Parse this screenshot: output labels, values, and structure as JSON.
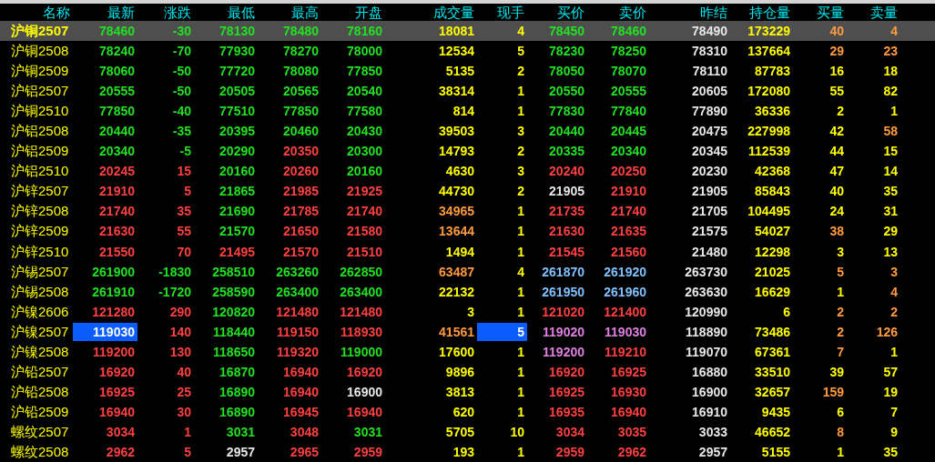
{
  "table": {
    "columns": [
      "名称",
      "最新",
      "涨跌",
      "最低",
      "最高",
      "开盘",
      "成交量",
      "现手",
      "买价",
      "卖价",
      "昨结",
      "持仓量",
      "买量",
      "卖量"
    ],
    "rows": [
      {
        "selected": true,
        "cells": [
          {
            "text": "沪铜2507",
            "color": "#ffff00",
            "highlighted": false
          },
          {
            "text": "78460",
            "color": "#22e022",
            "highlighted": false
          },
          {
            "text": "-30",
            "color": "#22e022",
            "highlighted": false
          },
          {
            "text": "78130",
            "color": "#22e022",
            "highlighted": false
          },
          {
            "text": "78480",
            "color": "#22e022",
            "highlighted": false
          },
          {
            "text": "78160",
            "color": "#22e022",
            "highlighted": false
          },
          {
            "text": "18081",
            "color": "#ffff00",
            "highlighted": false
          },
          {
            "text": "4",
            "color": "#ffff00",
            "highlighted": false
          },
          {
            "text": "78450",
            "color": "#22e022",
            "highlighted": false
          },
          {
            "text": "78460",
            "color": "#22e022",
            "highlighted": false
          },
          {
            "text": "78490",
            "color": "#e8e8e8",
            "highlighted": false
          },
          {
            "text": "173229",
            "color": "#ffff00",
            "highlighted": false
          },
          {
            "text": "40",
            "color": "#ff9a40",
            "highlighted": false
          },
          {
            "text": "4",
            "color": "#ff9a40",
            "highlighted": false
          }
        ]
      },
      {
        "selected": false,
        "cells": [
          {
            "text": "沪铜2508",
            "color": "#ffff00",
            "highlighted": false
          },
          {
            "text": "78240",
            "color": "#22e022",
            "highlighted": false
          },
          {
            "text": "-70",
            "color": "#22e022",
            "highlighted": false
          },
          {
            "text": "77930",
            "color": "#22e022",
            "highlighted": false
          },
          {
            "text": "78270",
            "color": "#22e022",
            "highlighted": false
          },
          {
            "text": "78000",
            "color": "#22e022",
            "highlighted": false
          },
          {
            "text": "12534",
            "color": "#ffff00",
            "highlighted": false
          },
          {
            "text": "5",
            "color": "#ffff00",
            "highlighted": false
          },
          {
            "text": "78230",
            "color": "#22e022",
            "highlighted": false
          },
          {
            "text": "78250",
            "color": "#22e022",
            "highlighted": false
          },
          {
            "text": "78310",
            "color": "#e8e8e8",
            "highlighted": false
          },
          {
            "text": "137664",
            "color": "#ffff00",
            "highlighted": false
          },
          {
            "text": "29",
            "color": "#ff9a40",
            "highlighted": false
          },
          {
            "text": "23",
            "color": "#ff9a40",
            "highlighted": false
          }
        ]
      },
      {
        "selected": false,
        "cells": [
          {
            "text": "沪铜2509",
            "color": "#ffff00",
            "highlighted": false
          },
          {
            "text": "78060",
            "color": "#22e022",
            "highlighted": false
          },
          {
            "text": "-50",
            "color": "#22e022",
            "highlighted": false
          },
          {
            "text": "77720",
            "color": "#22e022",
            "highlighted": false
          },
          {
            "text": "78080",
            "color": "#22e022",
            "highlighted": false
          },
          {
            "text": "77850",
            "color": "#22e022",
            "highlighted": false
          },
          {
            "text": "5135",
            "color": "#ffff00",
            "highlighted": false
          },
          {
            "text": "2",
            "color": "#ffff00",
            "highlighted": false
          },
          {
            "text": "78050",
            "color": "#22e022",
            "highlighted": false
          },
          {
            "text": "78070",
            "color": "#22e022",
            "highlighted": false
          },
          {
            "text": "78110",
            "color": "#e8e8e8",
            "highlighted": false
          },
          {
            "text": "87783",
            "color": "#ffff00",
            "highlighted": false
          },
          {
            "text": "16",
            "color": "#ffff00",
            "highlighted": false
          },
          {
            "text": "18",
            "color": "#ffff00",
            "highlighted": false
          }
        ]
      },
      {
        "selected": false,
        "cells": [
          {
            "text": "沪铝2507",
            "color": "#ffff00",
            "highlighted": false
          },
          {
            "text": "20555",
            "color": "#22e022",
            "highlighted": false
          },
          {
            "text": "-50",
            "color": "#22e022",
            "highlighted": false
          },
          {
            "text": "20505",
            "color": "#22e022",
            "highlighted": false
          },
          {
            "text": "20565",
            "color": "#22e022",
            "highlighted": false
          },
          {
            "text": "20540",
            "color": "#22e022",
            "highlighted": false
          },
          {
            "text": "38314",
            "color": "#ffff00",
            "highlighted": false
          },
          {
            "text": "1",
            "color": "#ffff00",
            "highlighted": false
          },
          {
            "text": "20550",
            "color": "#22e022",
            "highlighted": false
          },
          {
            "text": "20555",
            "color": "#22e022",
            "highlighted": false
          },
          {
            "text": "20605",
            "color": "#e8e8e8",
            "highlighted": false
          },
          {
            "text": "172080",
            "color": "#ffff00",
            "highlighted": false
          },
          {
            "text": "55",
            "color": "#ffff00",
            "highlighted": false
          },
          {
            "text": "82",
            "color": "#ffff00",
            "highlighted": false
          }
        ]
      },
      {
        "selected": false,
        "cells": [
          {
            "text": "沪铜2510",
            "color": "#ffff00",
            "highlighted": false
          },
          {
            "text": "77850",
            "color": "#22e022",
            "highlighted": false
          },
          {
            "text": "-40",
            "color": "#22e022",
            "highlighted": false
          },
          {
            "text": "77510",
            "color": "#22e022",
            "highlighted": false
          },
          {
            "text": "77850",
            "color": "#22e022",
            "highlighted": false
          },
          {
            "text": "77580",
            "color": "#22e022",
            "highlighted": false
          },
          {
            "text": "814",
            "color": "#ffff00",
            "highlighted": false
          },
          {
            "text": "1",
            "color": "#ffff00",
            "highlighted": false
          },
          {
            "text": "77830",
            "color": "#22e022",
            "highlighted": false
          },
          {
            "text": "77840",
            "color": "#22e022",
            "highlighted": false
          },
          {
            "text": "77890",
            "color": "#e8e8e8",
            "highlighted": false
          },
          {
            "text": "36336",
            "color": "#ffff00",
            "highlighted": false
          },
          {
            "text": "2",
            "color": "#ffff00",
            "highlighted": false
          },
          {
            "text": "1",
            "color": "#ffff00",
            "highlighted": false
          }
        ]
      },
      {
        "selected": false,
        "cells": [
          {
            "text": "沪铝2508",
            "color": "#ffff00",
            "highlighted": false
          },
          {
            "text": "20440",
            "color": "#22e022",
            "highlighted": false
          },
          {
            "text": "-35",
            "color": "#22e022",
            "highlighted": false
          },
          {
            "text": "20395",
            "color": "#22e022",
            "highlighted": false
          },
          {
            "text": "20460",
            "color": "#22e022",
            "highlighted": false
          },
          {
            "text": "20430",
            "color": "#22e022",
            "highlighted": false
          },
          {
            "text": "39503",
            "color": "#ffff00",
            "highlighted": false
          },
          {
            "text": "3",
            "color": "#ffff00",
            "highlighted": false
          },
          {
            "text": "20440",
            "color": "#22e022",
            "highlighted": false
          },
          {
            "text": "20445",
            "color": "#22e022",
            "highlighted": false
          },
          {
            "text": "20475",
            "color": "#e8e8e8",
            "highlighted": false
          },
          {
            "text": "227998",
            "color": "#ffff00",
            "highlighted": false
          },
          {
            "text": "42",
            "color": "#ffff00",
            "highlighted": false
          },
          {
            "text": "58",
            "color": "#ff9a40",
            "highlighted": false
          }
        ]
      },
      {
        "selected": false,
        "cells": [
          {
            "text": "沪铝2509",
            "color": "#ffff00",
            "highlighted": false
          },
          {
            "text": "20340",
            "color": "#22e022",
            "highlighted": false
          },
          {
            "text": "-5",
            "color": "#22e022",
            "highlighted": false
          },
          {
            "text": "20290",
            "color": "#22e022",
            "highlighted": false
          },
          {
            "text": "20350",
            "color": "#ff4040",
            "highlighted": false
          },
          {
            "text": "20300",
            "color": "#22e022",
            "highlighted": false
          },
          {
            "text": "14793",
            "color": "#ffff00",
            "highlighted": false
          },
          {
            "text": "2",
            "color": "#ffff00",
            "highlighted": false
          },
          {
            "text": "20335",
            "color": "#22e022",
            "highlighted": false
          },
          {
            "text": "20340",
            "color": "#22e022",
            "highlighted": false
          },
          {
            "text": "20345",
            "color": "#e8e8e8",
            "highlighted": false
          },
          {
            "text": "112539",
            "color": "#ffff00",
            "highlighted": false
          },
          {
            "text": "44",
            "color": "#ffff00",
            "highlighted": false
          },
          {
            "text": "15",
            "color": "#ffff00",
            "highlighted": false
          }
        ]
      },
      {
        "selected": false,
        "cells": [
          {
            "text": "沪铝2510",
            "color": "#ffff00",
            "highlighted": false
          },
          {
            "text": "20245",
            "color": "#ff4040",
            "highlighted": false
          },
          {
            "text": "15",
            "color": "#ff4040",
            "highlighted": false
          },
          {
            "text": "20160",
            "color": "#22e022",
            "highlighted": false
          },
          {
            "text": "20260",
            "color": "#ff4040",
            "highlighted": false
          },
          {
            "text": "20160",
            "color": "#22e022",
            "highlighted": false
          },
          {
            "text": "4630",
            "color": "#ffff00",
            "highlighted": false
          },
          {
            "text": "3",
            "color": "#ffff00",
            "highlighted": false
          },
          {
            "text": "20240",
            "color": "#ff4040",
            "highlighted": false
          },
          {
            "text": "20250",
            "color": "#ff4040",
            "highlighted": false
          },
          {
            "text": "20230",
            "color": "#e8e8e8",
            "highlighted": false
          },
          {
            "text": "42368",
            "color": "#ffff00",
            "highlighted": false
          },
          {
            "text": "47",
            "color": "#ffff00",
            "highlighted": false
          },
          {
            "text": "14",
            "color": "#ffff00",
            "highlighted": false
          }
        ]
      },
      {
        "selected": false,
        "cells": [
          {
            "text": "沪锌2507",
            "color": "#ffff00",
            "highlighted": false
          },
          {
            "text": "21910",
            "color": "#ff4040",
            "highlighted": false
          },
          {
            "text": "5",
            "color": "#ff4040",
            "highlighted": false
          },
          {
            "text": "21865",
            "color": "#22e022",
            "highlighted": false
          },
          {
            "text": "21985",
            "color": "#ff4040",
            "highlighted": false
          },
          {
            "text": "21925",
            "color": "#ff4040",
            "highlighted": false
          },
          {
            "text": "44730",
            "color": "#ffff00",
            "highlighted": false
          },
          {
            "text": "2",
            "color": "#ffff00",
            "highlighted": false
          },
          {
            "text": "21905",
            "color": "#e8e8e8",
            "highlighted": false
          },
          {
            "text": "21910",
            "color": "#ff4040",
            "highlighted": false
          },
          {
            "text": "21905",
            "color": "#e8e8e8",
            "highlighted": false
          },
          {
            "text": "85843",
            "color": "#ffff00",
            "highlighted": false
          },
          {
            "text": "40",
            "color": "#ffff00",
            "highlighted": false
          },
          {
            "text": "35",
            "color": "#ffff00",
            "highlighted": false
          }
        ]
      },
      {
        "selected": false,
        "cells": [
          {
            "text": "沪锌2508",
            "color": "#ffff00",
            "highlighted": false
          },
          {
            "text": "21740",
            "color": "#ff4040",
            "highlighted": false
          },
          {
            "text": "35",
            "color": "#ff4040",
            "highlighted": false
          },
          {
            "text": "21690",
            "color": "#22e022",
            "highlighted": false
          },
          {
            "text": "21785",
            "color": "#ff4040",
            "highlighted": false
          },
          {
            "text": "21740",
            "color": "#ff4040",
            "highlighted": false
          },
          {
            "text": "34965",
            "color": "#ff9a40",
            "highlighted": false
          },
          {
            "text": "1",
            "color": "#ffff00",
            "highlighted": false
          },
          {
            "text": "21735",
            "color": "#ff4040",
            "highlighted": false
          },
          {
            "text": "21740",
            "color": "#ff4040",
            "highlighted": false
          },
          {
            "text": "21705",
            "color": "#e8e8e8",
            "highlighted": false
          },
          {
            "text": "104495",
            "color": "#ffff00",
            "highlighted": false
          },
          {
            "text": "24",
            "color": "#ffff00",
            "highlighted": false
          },
          {
            "text": "31",
            "color": "#ffff00",
            "highlighted": false
          }
        ]
      },
      {
        "selected": false,
        "cells": [
          {
            "text": "沪锌2509",
            "color": "#ffff00",
            "highlighted": false
          },
          {
            "text": "21630",
            "color": "#ff4040",
            "highlighted": false
          },
          {
            "text": "55",
            "color": "#ff4040",
            "highlighted": false
          },
          {
            "text": "21570",
            "color": "#22e022",
            "highlighted": false
          },
          {
            "text": "21650",
            "color": "#ff4040",
            "highlighted": false
          },
          {
            "text": "21580",
            "color": "#ff4040",
            "highlighted": false
          },
          {
            "text": "13644",
            "color": "#ff9a40",
            "highlighted": false
          },
          {
            "text": "1",
            "color": "#ffff00",
            "highlighted": false
          },
          {
            "text": "21630",
            "color": "#ff4040",
            "highlighted": false
          },
          {
            "text": "21635",
            "color": "#ff4040",
            "highlighted": false
          },
          {
            "text": "21575",
            "color": "#e8e8e8",
            "highlighted": false
          },
          {
            "text": "54027",
            "color": "#ffff00",
            "highlighted": false
          },
          {
            "text": "38",
            "color": "#ff9a40",
            "highlighted": false
          },
          {
            "text": "29",
            "color": "#ffff00",
            "highlighted": false
          }
        ]
      },
      {
        "selected": false,
        "cells": [
          {
            "text": "沪锌2510",
            "color": "#ffff00",
            "highlighted": false
          },
          {
            "text": "21550",
            "color": "#ff4040",
            "highlighted": false
          },
          {
            "text": "70",
            "color": "#ff4040",
            "highlighted": false
          },
          {
            "text": "21495",
            "color": "#ff4040",
            "highlighted": false
          },
          {
            "text": "21570",
            "color": "#ff4040",
            "highlighted": false
          },
          {
            "text": "21510",
            "color": "#ff4040",
            "highlighted": false
          },
          {
            "text": "1494",
            "color": "#ffff00",
            "highlighted": false
          },
          {
            "text": "1",
            "color": "#ffff00",
            "highlighted": false
          },
          {
            "text": "21545",
            "color": "#ff4040",
            "highlighted": false
          },
          {
            "text": "21560",
            "color": "#ff4040",
            "highlighted": false
          },
          {
            "text": "21480",
            "color": "#e8e8e8",
            "highlighted": false
          },
          {
            "text": "12298",
            "color": "#ffff00",
            "highlighted": false
          },
          {
            "text": "3",
            "color": "#ffff00",
            "highlighted": false
          },
          {
            "text": "13",
            "color": "#ffff00",
            "highlighted": false
          }
        ]
      },
      {
        "selected": false,
        "cells": [
          {
            "text": "沪锡2507",
            "color": "#ffff00",
            "highlighted": false
          },
          {
            "text": "261900",
            "color": "#22e022",
            "highlighted": false
          },
          {
            "text": "-1830",
            "color": "#22e022",
            "highlighted": false
          },
          {
            "text": "258510",
            "color": "#22e022",
            "highlighted": false
          },
          {
            "text": "263260",
            "color": "#22e022",
            "highlighted": false
          },
          {
            "text": "262850",
            "color": "#22e022",
            "highlighted": false
          },
          {
            "text": "63487",
            "color": "#ff9a40",
            "highlighted": false
          },
          {
            "text": "4",
            "color": "#ffff00",
            "highlighted": false
          },
          {
            "text": "261870",
            "color": "#80c0ff",
            "highlighted": false
          },
          {
            "text": "261920",
            "color": "#80c0ff",
            "highlighted": false
          },
          {
            "text": "263730",
            "color": "#e8e8e8",
            "highlighted": false
          },
          {
            "text": "21025",
            "color": "#ffff00",
            "highlighted": false
          },
          {
            "text": "5",
            "color": "#ff9a40",
            "highlighted": false
          },
          {
            "text": "3",
            "color": "#ff9a40",
            "highlighted": false
          }
        ]
      },
      {
        "selected": false,
        "cells": [
          {
            "text": "沪锡2508",
            "color": "#ffff00",
            "highlighted": false
          },
          {
            "text": "261910",
            "color": "#22e022",
            "highlighted": false
          },
          {
            "text": "-1720",
            "color": "#22e022",
            "highlighted": false
          },
          {
            "text": "258590",
            "color": "#22e022",
            "highlighted": false
          },
          {
            "text": "263400",
            "color": "#22e022",
            "highlighted": false
          },
          {
            "text": "263400",
            "color": "#22e022",
            "highlighted": false
          },
          {
            "text": "22132",
            "color": "#ffff00",
            "highlighted": false
          },
          {
            "text": "1",
            "color": "#ffff00",
            "highlighted": false
          },
          {
            "text": "261950",
            "color": "#80c0ff",
            "highlighted": false
          },
          {
            "text": "261960",
            "color": "#80c0ff",
            "highlighted": false
          },
          {
            "text": "263630",
            "color": "#e8e8e8",
            "highlighted": false
          },
          {
            "text": "16629",
            "color": "#ffff00",
            "highlighted": false
          },
          {
            "text": "1",
            "color": "#ffff00",
            "highlighted": false
          },
          {
            "text": "4",
            "color": "#ff9a40",
            "highlighted": false
          }
        ]
      },
      {
        "selected": false,
        "cells": [
          {
            "text": "沪镍2606",
            "color": "#ffff00",
            "highlighted": false
          },
          {
            "text": "121280",
            "color": "#ff4040",
            "highlighted": false
          },
          {
            "text": "290",
            "color": "#ff4040",
            "highlighted": false
          },
          {
            "text": "120820",
            "color": "#22e022",
            "highlighted": false
          },
          {
            "text": "121480",
            "color": "#ff4040",
            "highlighted": false
          },
          {
            "text": "121480",
            "color": "#ff4040",
            "highlighted": false
          },
          {
            "text": "3",
            "color": "#ffff00",
            "highlighted": false
          },
          {
            "text": "1",
            "color": "#ffff00",
            "highlighted": false
          },
          {
            "text": "121020",
            "color": "#ff4040",
            "highlighted": false
          },
          {
            "text": "121400",
            "color": "#ff4040",
            "highlighted": false
          },
          {
            "text": "120990",
            "color": "#e8e8e8",
            "highlighted": false
          },
          {
            "text": "6",
            "color": "#ffff00",
            "highlighted": false
          },
          {
            "text": "2",
            "color": "#ff9a40",
            "highlighted": false
          },
          {
            "text": "2",
            "color": "#ff9a40",
            "highlighted": false
          }
        ]
      },
      {
        "selected": false,
        "cells": [
          {
            "text": "沪镍2507",
            "color": "#ffff00",
            "highlighted": false
          },
          {
            "text": "119030",
            "color": "#ffffff",
            "highlighted": true
          },
          {
            "text": "140",
            "color": "#ff4040",
            "highlighted": false
          },
          {
            "text": "118440",
            "color": "#22e022",
            "highlighted": false
          },
          {
            "text": "119150",
            "color": "#ff4040",
            "highlighted": false
          },
          {
            "text": "118930",
            "color": "#ff4040",
            "highlighted": false
          },
          {
            "text": "41561",
            "color": "#ff9a40",
            "highlighted": false
          },
          {
            "text": "5",
            "color": "#ffffff",
            "highlighted": true
          },
          {
            "text": "119020",
            "color": "#e080e0",
            "highlighted": false
          },
          {
            "text": "119030",
            "color": "#e080e0",
            "highlighted": false
          },
          {
            "text": "118890",
            "color": "#e8e8e8",
            "highlighted": false
          },
          {
            "text": "73486",
            "color": "#ffff00",
            "highlighted": false
          },
          {
            "text": "2",
            "color": "#ff9a40",
            "highlighted": false
          },
          {
            "text": "126",
            "color": "#ff9a40",
            "highlighted": false
          }
        ]
      },
      {
        "selected": false,
        "cells": [
          {
            "text": "沪镍2508",
            "color": "#ffff00",
            "highlighted": false
          },
          {
            "text": "119200",
            "color": "#ff4040",
            "highlighted": false
          },
          {
            "text": "130",
            "color": "#ff4040",
            "highlighted": false
          },
          {
            "text": "118650",
            "color": "#22e022",
            "highlighted": false
          },
          {
            "text": "119320",
            "color": "#ff4040",
            "highlighted": false
          },
          {
            "text": "119000",
            "color": "#22e022",
            "highlighted": false
          },
          {
            "text": "17600",
            "color": "#ffff00",
            "highlighted": false
          },
          {
            "text": "1",
            "color": "#ffff00",
            "highlighted": false
          },
          {
            "text": "119200",
            "color": "#e080e0",
            "highlighted": false
          },
          {
            "text": "119210",
            "color": "#ff4040",
            "highlighted": false
          },
          {
            "text": "119070",
            "color": "#e8e8e8",
            "highlighted": false
          },
          {
            "text": "67361",
            "color": "#ffff00",
            "highlighted": false
          },
          {
            "text": "7",
            "color": "#ff9a40",
            "highlighted": false
          },
          {
            "text": "1",
            "color": "#ffff00",
            "highlighted": false
          }
        ]
      },
      {
        "selected": false,
        "cells": [
          {
            "text": "沪铅2507",
            "color": "#ffff00",
            "highlighted": false
          },
          {
            "text": "16920",
            "color": "#ff4040",
            "highlighted": false
          },
          {
            "text": "40",
            "color": "#ff4040",
            "highlighted": false
          },
          {
            "text": "16870",
            "color": "#22e022",
            "highlighted": false
          },
          {
            "text": "16940",
            "color": "#ff4040",
            "highlighted": false
          },
          {
            "text": "16920",
            "color": "#ff4040",
            "highlighted": false
          },
          {
            "text": "9896",
            "color": "#ffff00",
            "highlighted": false
          },
          {
            "text": "1",
            "color": "#ffff00",
            "highlighted": false
          },
          {
            "text": "16920",
            "color": "#ff4040",
            "highlighted": false
          },
          {
            "text": "16925",
            "color": "#ff4040",
            "highlighted": false
          },
          {
            "text": "16880",
            "color": "#e8e8e8",
            "highlighted": false
          },
          {
            "text": "33510",
            "color": "#ffff00",
            "highlighted": false
          },
          {
            "text": "39",
            "color": "#ffff00",
            "highlighted": false
          },
          {
            "text": "57",
            "color": "#ffff00",
            "highlighted": false
          }
        ]
      },
      {
        "selected": false,
        "cells": [
          {
            "text": "沪铅2508",
            "color": "#ffff00",
            "highlighted": false
          },
          {
            "text": "16925",
            "color": "#ff4040",
            "highlighted": false
          },
          {
            "text": "25",
            "color": "#ff4040",
            "highlighted": false
          },
          {
            "text": "16890",
            "color": "#22e022",
            "highlighted": false
          },
          {
            "text": "16940",
            "color": "#ff4040",
            "highlighted": false
          },
          {
            "text": "16900",
            "color": "#e8e8e8",
            "highlighted": false
          },
          {
            "text": "3813",
            "color": "#ffff00",
            "highlighted": false
          },
          {
            "text": "1",
            "color": "#ffff00",
            "highlighted": false
          },
          {
            "text": "16925",
            "color": "#ff4040",
            "highlighted": false
          },
          {
            "text": "16930",
            "color": "#ff4040",
            "highlighted": false
          },
          {
            "text": "16900",
            "color": "#e8e8e8",
            "highlighted": false
          },
          {
            "text": "32657",
            "color": "#ffff00",
            "highlighted": false
          },
          {
            "text": "159",
            "color": "#ff9a40",
            "highlighted": false
          },
          {
            "text": "19",
            "color": "#ffff00",
            "highlighted": false
          }
        ]
      },
      {
        "selected": false,
        "cells": [
          {
            "text": "沪铅2509",
            "color": "#ffff00",
            "highlighted": false
          },
          {
            "text": "16940",
            "color": "#ff4040",
            "highlighted": false
          },
          {
            "text": "30",
            "color": "#ff4040",
            "highlighted": false
          },
          {
            "text": "16890",
            "color": "#22e022",
            "highlighted": false
          },
          {
            "text": "16945",
            "color": "#ff4040",
            "highlighted": false
          },
          {
            "text": "16940",
            "color": "#ff4040",
            "highlighted": false
          },
          {
            "text": "620",
            "color": "#ffff00",
            "highlighted": false
          },
          {
            "text": "1",
            "color": "#ffff00",
            "highlighted": false
          },
          {
            "text": "16935",
            "color": "#ff4040",
            "highlighted": false
          },
          {
            "text": "16940",
            "color": "#ff4040",
            "highlighted": false
          },
          {
            "text": "16910",
            "color": "#e8e8e8",
            "highlighted": false
          },
          {
            "text": "9435",
            "color": "#ffff00",
            "highlighted": false
          },
          {
            "text": "6",
            "color": "#ffff00",
            "highlighted": false
          },
          {
            "text": "7",
            "color": "#ffff00",
            "highlighted": false
          }
        ]
      },
      {
        "selected": false,
        "cells": [
          {
            "text": "螺纹2507",
            "color": "#ffff00",
            "highlighted": false
          },
          {
            "text": "3034",
            "color": "#ff4040",
            "highlighted": false
          },
          {
            "text": "1",
            "color": "#ff4040",
            "highlighted": false
          },
          {
            "text": "3031",
            "color": "#22e022",
            "highlighted": false
          },
          {
            "text": "3048",
            "color": "#ff4040",
            "highlighted": false
          },
          {
            "text": "3031",
            "color": "#22e022",
            "highlighted": false
          },
          {
            "text": "5705",
            "color": "#ffff00",
            "highlighted": false
          },
          {
            "text": "10",
            "color": "#ffff00",
            "highlighted": false
          },
          {
            "text": "3034",
            "color": "#ff4040",
            "highlighted": false
          },
          {
            "text": "3035",
            "color": "#ff4040",
            "highlighted": false
          },
          {
            "text": "3033",
            "color": "#e8e8e8",
            "highlighted": false
          },
          {
            "text": "46652",
            "color": "#ffff00",
            "highlighted": false
          },
          {
            "text": "8",
            "color": "#ff9a40",
            "highlighted": false
          },
          {
            "text": "9",
            "color": "#ffff00",
            "highlighted": false
          }
        ]
      },
      {
        "selected": false,
        "cells": [
          {
            "text": "螺纹2508",
            "color": "#ffff00",
            "highlighted": false
          },
          {
            "text": "2962",
            "color": "#ff4040",
            "highlighted": false
          },
          {
            "text": "5",
            "color": "#ff4040",
            "highlighted": false
          },
          {
            "text": "2957",
            "color": "#e8e8e8",
            "highlighted": false
          },
          {
            "text": "2965",
            "color": "#ff4040",
            "highlighted": false
          },
          {
            "text": "2959",
            "color": "#ff4040",
            "highlighted": false
          },
          {
            "text": "193",
            "color": "#ffff00",
            "highlighted": false
          },
          {
            "text": "1",
            "color": "#ffff00",
            "highlighted": false
          },
          {
            "text": "2959",
            "color": "#ff4040",
            "highlighted": false
          },
          {
            "text": "2962",
            "color": "#ff4040",
            "highlighted": false
          },
          {
            "text": "2957",
            "color": "#e8e8e8",
            "highlighted": false
          },
          {
            "text": "5155",
            "color": "#ffff00",
            "highlighted": false
          },
          {
            "text": "1",
            "color": "#ffff00",
            "highlighted": false
          },
          {
            "text": "35",
            "color": "#ffff00",
            "highlighted": false
          }
        ]
      }
    ]
  }
}
